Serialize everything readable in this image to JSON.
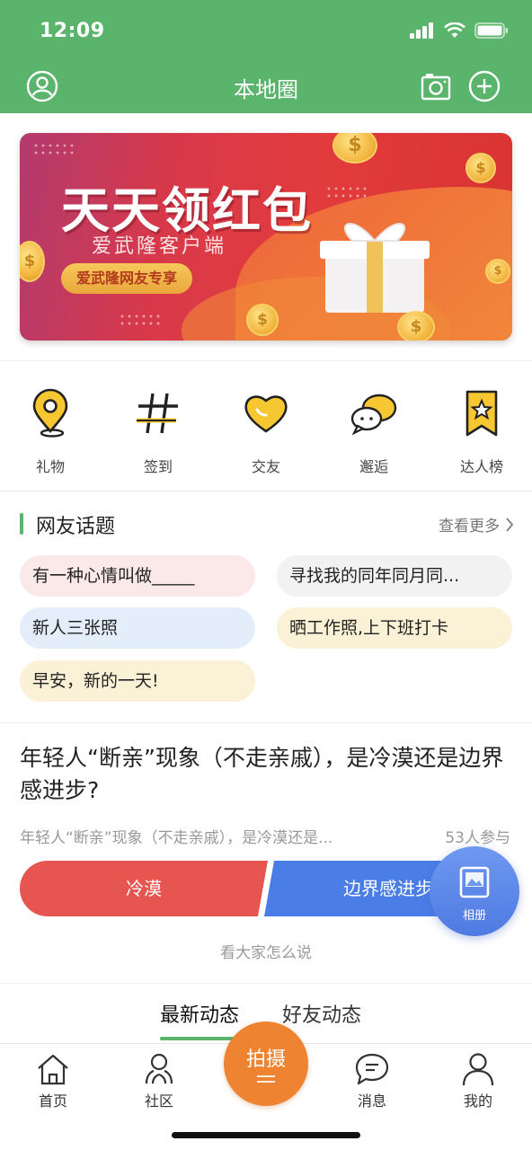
{
  "status_bar": {
    "time": "12:09"
  },
  "nav": {
    "title": "本地圈",
    "profile_icon": "user-circle-icon",
    "camera_icon": "camera-icon",
    "add_icon": "plus-circle-icon"
  },
  "banner": {
    "title": "天天领红包",
    "subtitle": "爱武隆客户端",
    "pill": "爱武隆网友专享"
  },
  "categories": [
    {
      "label": "礼物",
      "icon": "location-pin-icon"
    },
    {
      "label": "签到",
      "icon": "hashtag-icon"
    },
    {
      "label": "交友",
      "icon": "heart-icon"
    },
    {
      "label": "邂逅",
      "icon": "chat-bubbles-icon"
    },
    {
      "label": "达人榜",
      "icon": "star-bookmark-icon"
    }
  ],
  "topics": {
    "title": "网友话题",
    "more": "查看更多",
    "items": [
      {
        "text": "有一种心情叫做_____",
        "color": "#fbe9ea"
      },
      {
        "text": "寻找我的同年同月同...",
        "color": "#f2f2f2"
      },
      {
        "text": "新人三张照",
        "color": "#e3eefa"
      },
      {
        "text": "晒工作照,上下班打卡",
        "color": "#fbf1d7"
      },
      {
        "text": "早安，新的一天!",
        "color": "#fbf1d7"
      }
    ]
  },
  "poll": {
    "question": "年轻人“断亲”现象（不走亲戚），是冷漠还是边界感进步?",
    "description": "年轻人“断亲”现象（不走亲戚），是冷漠还是...",
    "participants": "53人参与",
    "option_a": "冷漠",
    "option_b": "边界感进步",
    "see_all": "看大家怎么说"
  },
  "album_button": {
    "label": "相册",
    "icon": "image-icon"
  },
  "feed_tabs": {
    "latest": "最新动态",
    "friends": "好友动态"
  },
  "tabbar": {
    "home": "首页",
    "community": "社区",
    "shoot": "拍摄",
    "messages": "消息",
    "mine": "我的"
  },
  "colors": {
    "primary": "#5bb46b",
    "poll_red": "#e6554f",
    "poll_blue": "#4a7ee6",
    "shoot_orange": "#ee8331"
  }
}
